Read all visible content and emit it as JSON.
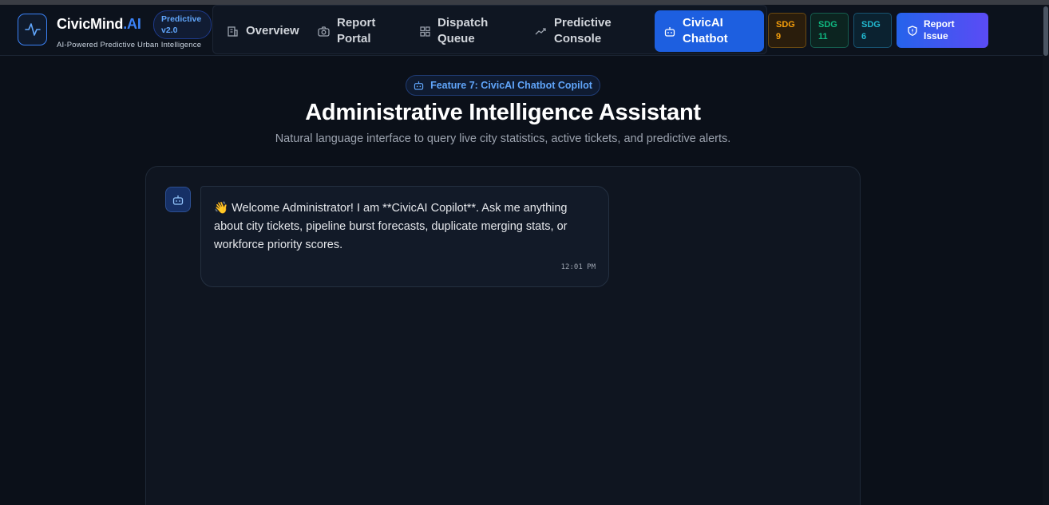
{
  "header": {
    "brand_main": "CivicMind",
    "brand_accent": ".AI",
    "tagline": "AI-Powered Predictive Urban Intelligence",
    "version_line1": "Predictive",
    "version_line2": "v2.0"
  },
  "nav": {
    "items": [
      {
        "label": "Overview",
        "icon": "building-icon"
      },
      {
        "label_line1": "Report",
        "label_line2": "Portal",
        "icon": "camera-icon"
      },
      {
        "label_line1": "Dispatch",
        "label_line2": "Queue",
        "icon": "grid-icon"
      },
      {
        "label_line1": "Predictive",
        "label_line2": "Console",
        "icon": "trend-icon"
      },
      {
        "label_line1": "CivicAI",
        "label_line2": "Chatbot",
        "icon": "bot-icon",
        "active": true
      }
    ]
  },
  "sdg": [
    {
      "line1": "SDG",
      "line2": "9",
      "color": "#f59e0b"
    },
    {
      "line1": "SDG",
      "line2": "11",
      "color": "#10b981"
    },
    {
      "line1": "SDG",
      "line2": "6",
      "color": "#22b8cf"
    }
  ],
  "report_button": {
    "line1": "Report",
    "line2": "Issue"
  },
  "hero": {
    "feature_label": "Feature 7: CivicAI Chatbot Copilot",
    "title": "Administrative Intelligence Assistant",
    "subtitle": "Natural language interface to query live city statistics, active tickets, and predictive alerts."
  },
  "chat": {
    "messages": [
      {
        "sender": "bot",
        "text": "👋 Welcome Administrator! I am **CivicAI Copilot**. Ask me anything about city tickets, pipeline burst forecasts, duplicate merging stats, or workforce priority scores.",
        "time": "12:01 PM"
      }
    ]
  },
  "colors": {
    "accent": "#3b82f6",
    "active_nav": "#1d5fe0",
    "background": "#0b1019"
  }
}
